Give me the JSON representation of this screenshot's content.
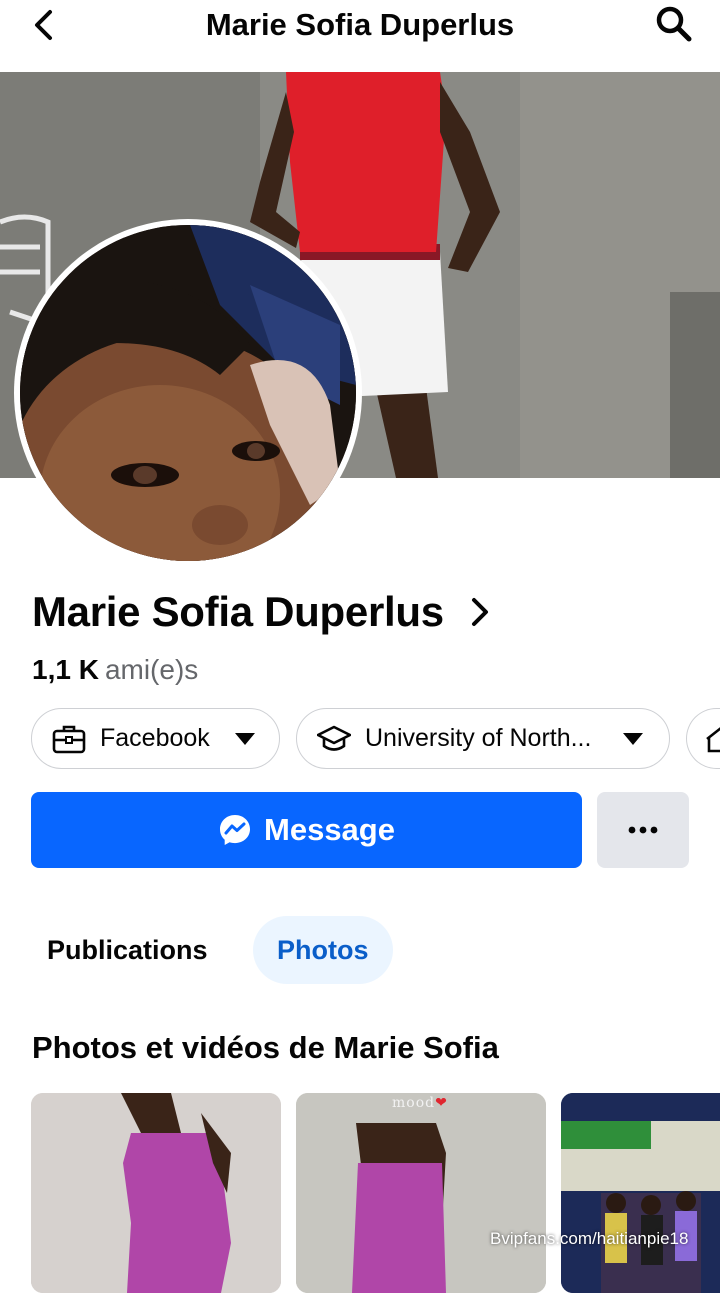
{
  "header": {
    "title": "Marie Sofia Duperlus"
  },
  "profile": {
    "name": "Marie Sofia Duperlus",
    "friends_count": "1,1 K",
    "friends_label": "ami(e)s"
  },
  "chips": [
    {
      "label": "Facebook",
      "icon": "briefcase-icon"
    },
    {
      "label": "University of North...",
      "icon": "graduation-cap-icon"
    },
    {
      "label": "",
      "icon": "home-icon"
    }
  ],
  "actions": {
    "message_label": "Message",
    "message_icon": "messenger-icon",
    "more_icon": "more-dots-icon"
  },
  "tabs": [
    {
      "label": "Publications",
      "active": false
    },
    {
      "label": "Photos",
      "active": true
    }
  ],
  "photos_section": {
    "title": "Photos et vidéos de Marie Sofia",
    "thumb_caption": "mood"
  },
  "overlay": {
    "watermark": "Bvipfans.com/haitianpie18"
  },
  "colors": {
    "primary": "#0866ff",
    "active_tab_bg": "#ebf5ff",
    "active_tab_text": "#0a5ec9",
    "secondary_button": "#e4e6eb",
    "muted_text": "#65676b"
  }
}
